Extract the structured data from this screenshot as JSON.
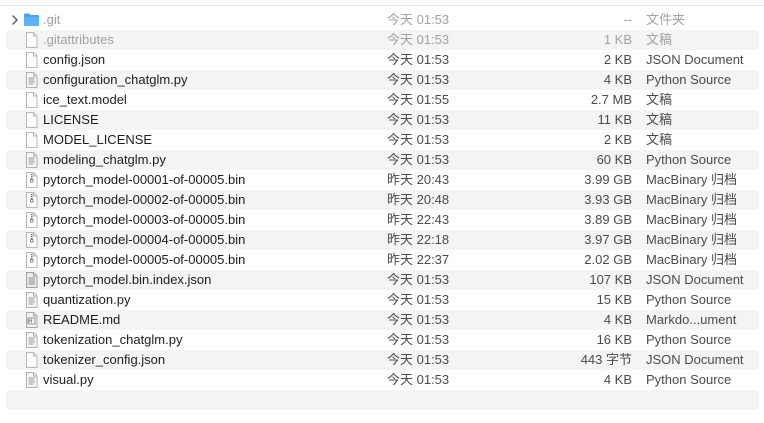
{
  "colors": {
    "folder_blue": "#4aa3f0",
    "stripe": "#f4f4f5",
    "text": "#1d1d1f",
    "muted_text": "#a1a1a6"
  },
  "files": [
    {
      "name": ".git",
      "date": "今天 01:53",
      "size": "--",
      "kind": "文件夹",
      "icon": "folder-icon",
      "hidden": true,
      "disclosure": true
    },
    {
      "name": ".gitattributes",
      "date": "今天 01:53",
      "size": "1 KB",
      "kind": "文稿",
      "icon": "document-icon",
      "hidden": true
    },
    {
      "name": "config.json",
      "date": "今天 01:53",
      "size": "2 KB",
      "kind": "JSON Document",
      "icon": "document-icon"
    },
    {
      "name": "configuration_chatglm.py",
      "date": "今天 01:53",
      "size": "4 KB",
      "kind": "Python Source",
      "icon": "script-icon"
    },
    {
      "name": "ice_text.model",
      "date": "今天 01:55",
      "size": "2.7 MB",
      "kind": "文稿",
      "icon": "document-icon"
    },
    {
      "name": "LICENSE",
      "date": "今天 01:53",
      "size": "11 KB",
      "kind": "文稿",
      "icon": "document-icon"
    },
    {
      "name": "MODEL_LICENSE",
      "date": "今天 01:53",
      "size": "2 KB",
      "kind": "文稿",
      "icon": "document-icon"
    },
    {
      "name": "modeling_chatglm.py",
      "date": "今天 01:53",
      "size": "60 KB",
      "kind": "Python Source",
      "icon": "script-icon"
    },
    {
      "name": "pytorch_model-00001-of-00005.bin",
      "date": "昨天 20:43",
      "size": "3.99 GB",
      "kind": "MacBinary 归档",
      "icon": "binary-icon"
    },
    {
      "name": "pytorch_model-00002-of-00005.bin",
      "date": "昨天 20:48",
      "size": "3.93 GB",
      "kind": "MacBinary 归档",
      "icon": "binary-icon"
    },
    {
      "name": "pytorch_model-00003-of-00005.bin",
      "date": "昨天 22:43",
      "size": "3.89 GB",
      "kind": "MacBinary 归档",
      "icon": "binary-icon"
    },
    {
      "name": "pytorch_model-00004-of-00005.bin",
      "date": "昨天 22:18",
      "size": "3.97 GB",
      "kind": "MacBinary 归档",
      "icon": "binary-icon"
    },
    {
      "name": "pytorch_model-00005-of-00005.bin",
      "date": "昨天 22:37",
      "size": "2.02 GB",
      "kind": "MacBinary 归档",
      "icon": "binary-icon"
    },
    {
      "name": "pytorch_model.bin.index.json",
      "date": "今天 01:53",
      "size": "107 KB",
      "kind": "JSON Document",
      "icon": "json-icon"
    },
    {
      "name": "quantization.py",
      "date": "今天 01:53",
      "size": "15 KB",
      "kind": "Python Source",
      "icon": "script-icon"
    },
    {
      "name": "README.md",
      "date": "今天 01:53",
      "size": "4 KB",
      "kind": "Markdo...ument",
      "icon": "markdown-icon"
    },
    {
      "name": "tokenization_chatglm.py",
      "date": "今天 01:53",
      "size": "16 KB",
      "kind": "Python Source",
      "icon": "script-icon"
    },
    {
      "name": "tokenizer_config.json",
      "date": "今天 01:53",
      "size": "443 字节",
      "kind": "JSON Document",
      "icon": "document-icon"
    },
    {
      "name": "visual.py",
      "date": "今天 01:53",
      "size": "4 KB",
      "kind": "Python Source",
      "icon": "script-icon"
    }
  ]
}
